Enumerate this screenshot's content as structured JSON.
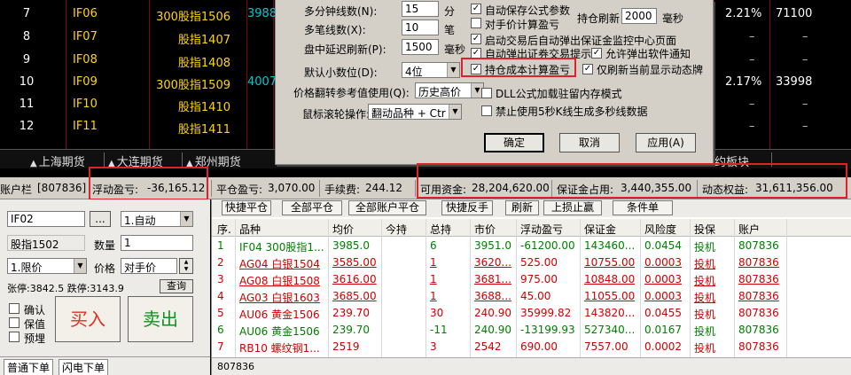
{
  "quote_rows": [
    {
      "num": "7",
      "code": "IF06",
      "name": "300股指1506",
      "extra": "3988",
      "pct": "2.21%",
      "vol": "71100",
      "d1": "",
      "d2": ""
    },
    {
      "num": "8",
      "code": "IF07",
      "name": "股指1407",
      "extra": "",
      "pct": "",
      "vol": "",
      "d1": "–",
      "d2": "–"
    },
    {
      "num": "9",
      "code": "IF08",
      "name": "股指1408",
      "extra": "",
      "pct": "",
      "vol": "",
      "d1": "–",
      "d2": "–"
    },
    {
      "num": "10",
      "code": "IF09",
      "name": "300股指1509",
      "extra": "4007",
      "pct": "2.17%",
      "vol": "33998",
      "d1": "",
      "d2": ""
    },
    {
      "num": "11",
      "code": "IF10",
      "name": "股指1410",
      "extra": "",
      "pct": "",
      "vol": "",
      "d1": "–",
      "d2": "–"
    },
    {
      "num": "12",
      "code": "IF11",
      "name": "股指1411",
      "extra": "",
      "pct": "",
      "vol": "",
      "d1": "–",
      "d2": "–"
    }
  ],
  "market_tabs": [
    "上海期货",
    "大连期货",
    "郑州期货",
    "约板块"
  ],
  "dialog": {
    "min_period_label": "多分钟线数(N):",
    "min_period_value": "15",
    "min_unit": "分",
    "multi_label": "多笔线数(X):",
    "multi_value": "10",
    "multi_unit": "笔",
    "delay_label": "盘中延迟刷新(P):",
    "delay_value": "1500",
    "delay_unit": "毫秒",
    "decimal_label": "默认小数位(D):",
    "decimal_value": "4位",
    "price_ref_label": "价格翻转参考值使用(Q):",
    "price_ref_value": "历史高价",
    "wheel_label": "鼠标滚轮操作:",
    "wheel_value": "翻动品种 + Ctr",
    "hold_refresh_label": "持仓刷新",
    "hold_refresh_value": "2000",
    "hold_refresh_unit": "毫秒",
    "checks": [
      {
        "label": "自动保存公式参数",
        "checked": true
      },
      {
        "label": "对手价计算盈亏",
        "checked": false
      },
      {
        "label": "启动交易后自动弹出保证金监控中心页面",
        "checked": true
      },
      {
        "label": "自动弹出证券交易提示",
        "checked": true
      },
      {
        "label": "允许弹出软件通知",
        "checked": true
      },
      {
        "label": "持仓成本计算盈亏",
        "checked": true
      },
      {
        "label": "仅刷新当前显示动态牌",
        "checked": true
      },
      {
        "label": "DLL公式加载驻留内存模式",
        "checked": false
      },
      {
        "label": "禁止使用5秒K线生成多秒线数据",
        "checked": false
      }
    ],
    "ok_label": "确定",
    "cancel_label": "取消",
    "apply_label": "应用(A)"
  },
  "account": {
    "label": "账户栏",
    "account_id": "[807836]",
    "float_pl_label": "浮动盈亏:",
    "float_pl": "-36,165.12",
    "close_pl_label": "平仓盈亏:",
    "close_pl": "3,070.00",
    "fee_label": "手续费:",
    "fee": "244.12",
    "avail_label": "可用资金:",
    "avail": "28,204,620.00",
    "margin_label": "保证金占用:",
    "margin": "3,440,355.00",
    "equity_label": "动态权益:",
    "equity": "31,611,356.00"
  },
  "order": {
    "contract": "IF02",
    "browse": "...",
    "mode": "1.自动",
    "name": "股指1502",
    "qty_label": "数量",
    "qty": "1",
    "price_type": "1.限价",
    "price_label": "价格",
    "price": "对手价",
    "limit_info": "张停:3842.5 跌停:3143.9",
    "query": "查询",
    "chk_confirm": "确认",
    "chk_hedge": "保值",
    "chk_preorder": "预埋",
    "buy": "买入",
    "sell": "卖出",
    "tab_normal": "普通下单",
    "tab_flash": "闪电下单"
  },
  "pos_toolbar": [
    "快捷平仓",
    "全部平仓",
    "全部账户平仓",
    "快捷反手",
    "刷新",
    "上损止赢",
    "条件单"
  ],
  "pos_headers": [
    "序.",
    "品种",
    "均价",
    "今持",
    "总持",
    "市价",
    "浮动盈亏",
    "保证金",
    "风险度",
    "投保",
    "账户"
  ],
  "positions": [
    {
      "seq": "1",
      "name": "IF04 300股指1...",
      "avg": "3985.0",
      "today": "",
      "total": "6",
      "mkt": "3951.0",
      "fpl": "-61200.00",
      "margin": "143460...",
      "risk": "0.0454",
      "hedge": "投机",
      "acct": "807836",
      "color": "grn",
      "ul": false
    },
    {
      "seq": "2",
      "name": "AG04 白银1504",
      "avg": "3585.00",
      "today": "",
      "total": "1",
      "mkt": "3620...",
      "fpl": "525.00",
      "margin": "10755.00",
      "risk": "0.0003",
      "hedge": "投机",
      "acct": "807836",
      "color": "red",
      "ul": true
    },
    {
      "seq": "3",
      "name": "AG08 白银1508",
      "avg": "3616.00",
      "today": "",
      "total": "1",
      "mkt": "3681...",
      "fpl": "975.00",
      "margin": "10848.00",
      "risk": "0.0003",
      "hedge": "投机",
      "acct": "807836",
      "color": "red",
      "ul": true
    },
    {
      "seq": "4",
      "name": "AG03 白银1603",
      "avg": "3685.00",
      "today": "",
      "total": "1",
      "mkt": "3688...",
      "fpl": "45.00",
      "margin": "11055.00",
      "risk": "0.0003",
      "hedge": "投机",
      "acct": "807836",
      "color": "red",
      "ul": true
    },
    {
      "seq": "5",
      "name": "AU06 黄金1506",
      "avg": "239.70",
      "today": "",
      "total": "30",
      "mkt": "240.90",
      "fpl": "35999.82",
      "margin": "143820...",
      "risk": "0.0455",
      "hedge": "投机",
      "acct": "807836",
      "color": "red",
      "ul": false
    },
    {
      "seq": "6",
      "name": "AU06 黄金1506",
      "avg": "239.70",
      "today": "",
      "total": "-11",
      "mkt": "240.90",
      "fpl": "-13199.93",
      "margin": "527340...",
      "risk": "0.0167",
      "hedge": "投机",
      "acct": "807836",
      "color": "grn",
      "ul": false
    },
    {
      "seq": "7",
      "name": "RB10 螺纹钢1...",
      "avg": "2519",
      "today": "",
      "total": "3",
      "mkt": "2542",
      "fpl": "690.00",
      "margin": "7557.00",
      "risk": "0.0002",
      "hedge": "投机",
      "acct": "807836",
      "color": "red",
      "ul": false
    }
  ],
  "pos_footer": "807836"
}
